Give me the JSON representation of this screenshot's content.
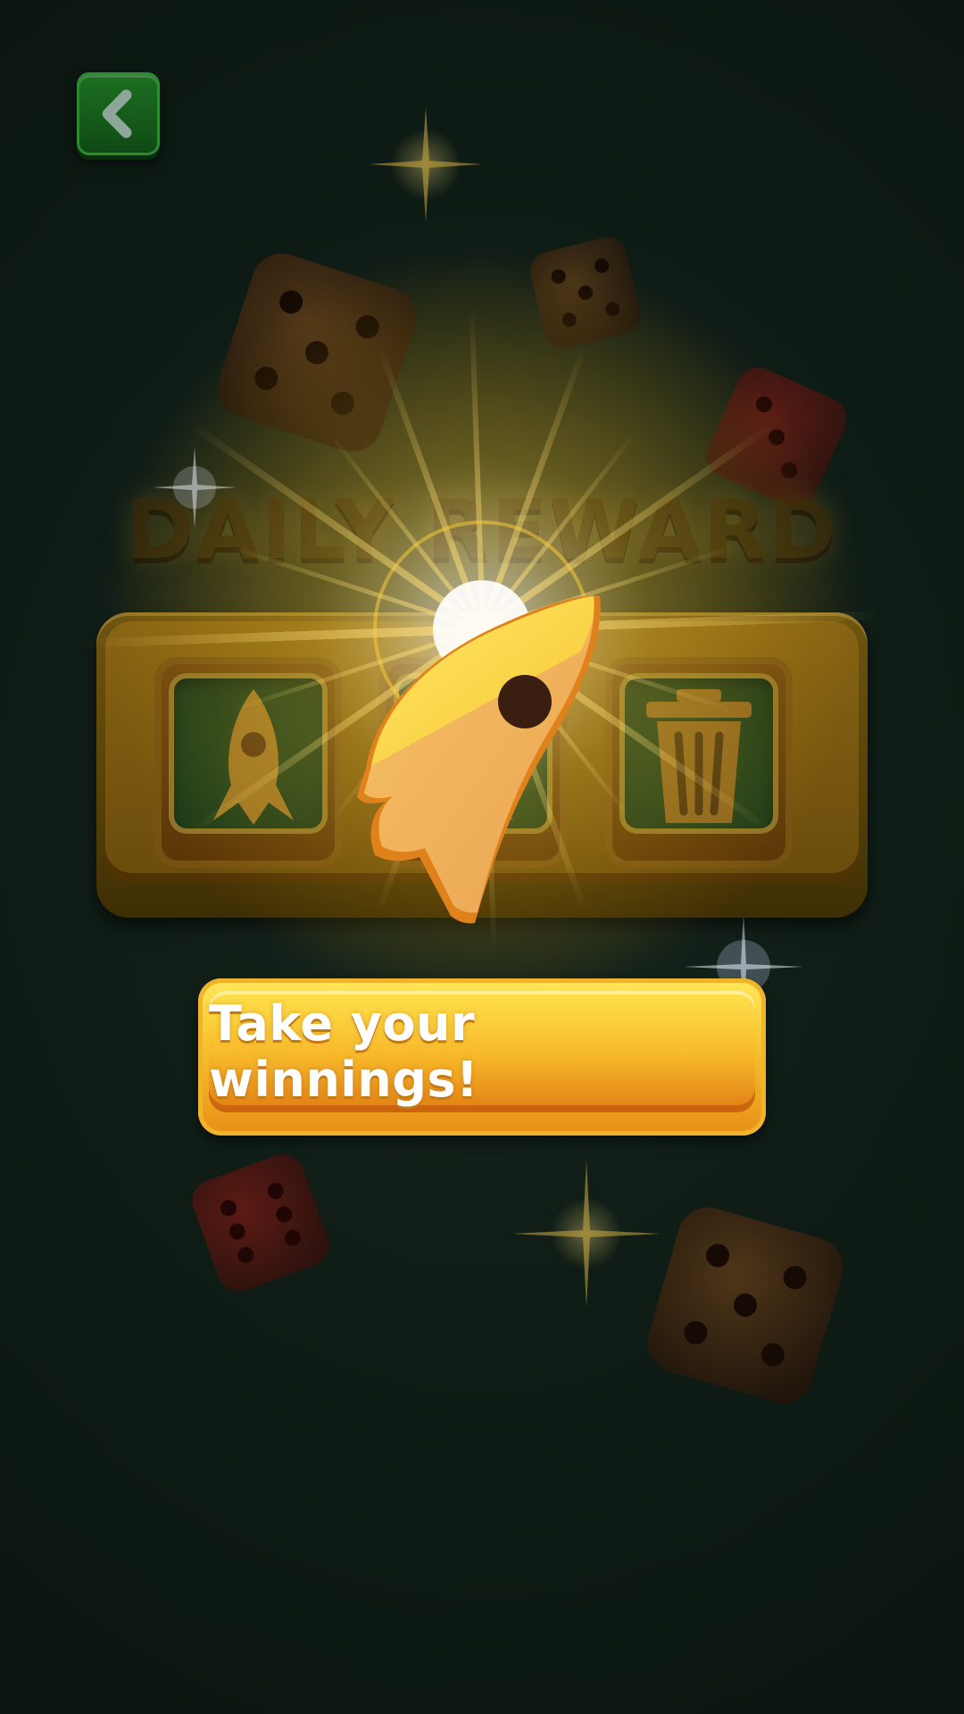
{
  "screen": {
    "title": "DAILY REWARD",
    "reward_slots": [
      {
        "icon": "rocket-icon"
      },
      {
        "icon": "rocket-icon"
      },
      {
        "icon": "trash-can-icon"
      }
    ],
    "featured_reward_icon": "rocket-icon",
    "claim_button_label": "Take your winnings!",
    "back_button_icon": "chevron-left-icon"
  },
  "colors": {
    "background": "#0f1c16",
    "accent_gold": "#f6c22d",
    "button_green": "#1d6e22",
    "glow": "#ffd84a"
  }
}
